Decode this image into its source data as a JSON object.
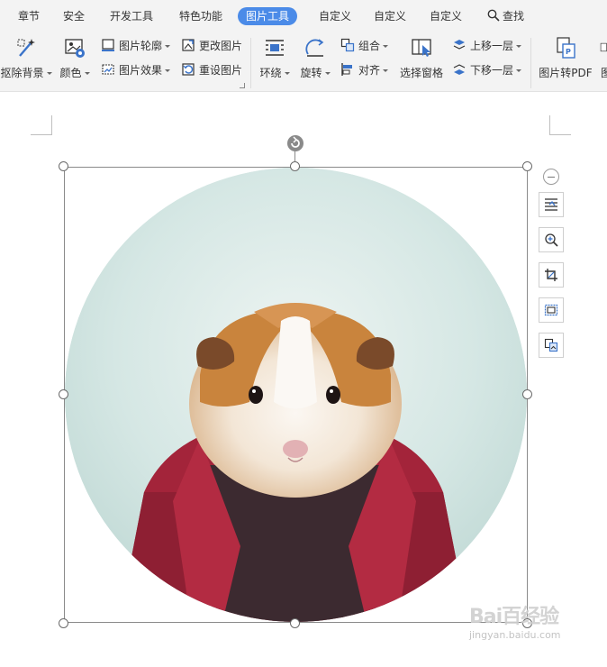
{
  "tabs": [
    {
      "label": "章节"
    },
    {
      "label": "安全"
    },
    {
      "label": "开发工具"
    },
    {
      "label": "特色功能"
    },
    {
      "label": "图片工具",
      "active": true
    },
    {
      "label": "自定义"
    },
    {
      "label": "自定义"
    },
    {
      "label": "自定义"
    },
    {
      "label": "查找",
      "icon": "search-icon"
    }
  ],
  "ribbon": {
    "remove_bg": {
      "label": "抠除背景",
      "icon": "magic-wand-icon"
    },
    "color": {
      "label": "颜色",
      "icon": "color-picture-icon"
    },
    "outline": {
      "label": "图片轮廓",
      "icon": "picture-outline-icon"
    },
    "effects": {
      "label": "图片效果",
      "icon": "picture-effects-icon"
    },
    "change": {
      "label": "更改图片",
      "icon": "change-picture-icon"
    },
    "reset": {
      "label": "重设图片",
      "icon": "reset-picture-icon"
    },
    "wrap": {
      "label": "环绕",
      "icon": "text-wrap-icon"
    },
    "rotate": {
      "label": "旋转",
      "icon": "rotate-icon"
    },
    "group": {
      "label": "组合",
      "icon": "group-icon"
    },
    "align": {
      "label": "对齐",
      "icon": "align-icon"
    },
    "selection_pane": {
      "label": "选择窗格",
      "icon": "selection-pane-icon"
    },
    "bring_forward": {
      "label": "上移一层",
      "icon": "bring-forward-icon"
    },
    "send_backward": {
      "label": "下移一层",
      "icon": "send-backward-icon"
    },
    "to_pdf": {
      "label": "图片转PDF",
      "icon": "picture-to-pdf-icon"
    }
  },
  "side_tools": [
    {
      "name": "layout-options-icon"
    },
    {
      "name": "zoom-in-icon"
    },
    {
      "name": "crop-icon"
    },
    {
      "name": "picture-frame-icon"
    },
    {
      "name": "change-picture-icon"
    }
  ],
  "watermark": {
    "text": "Bai百经验",
    "url": "jingyan.baidu.com"
  },
  "colors": {
    "active_tab": "#4b8be8",
    "ribbon_bg": "#f3f3f3",
    "jacket": "#a3243a",
    "fur_orange": "#c9843d"
  }
}
